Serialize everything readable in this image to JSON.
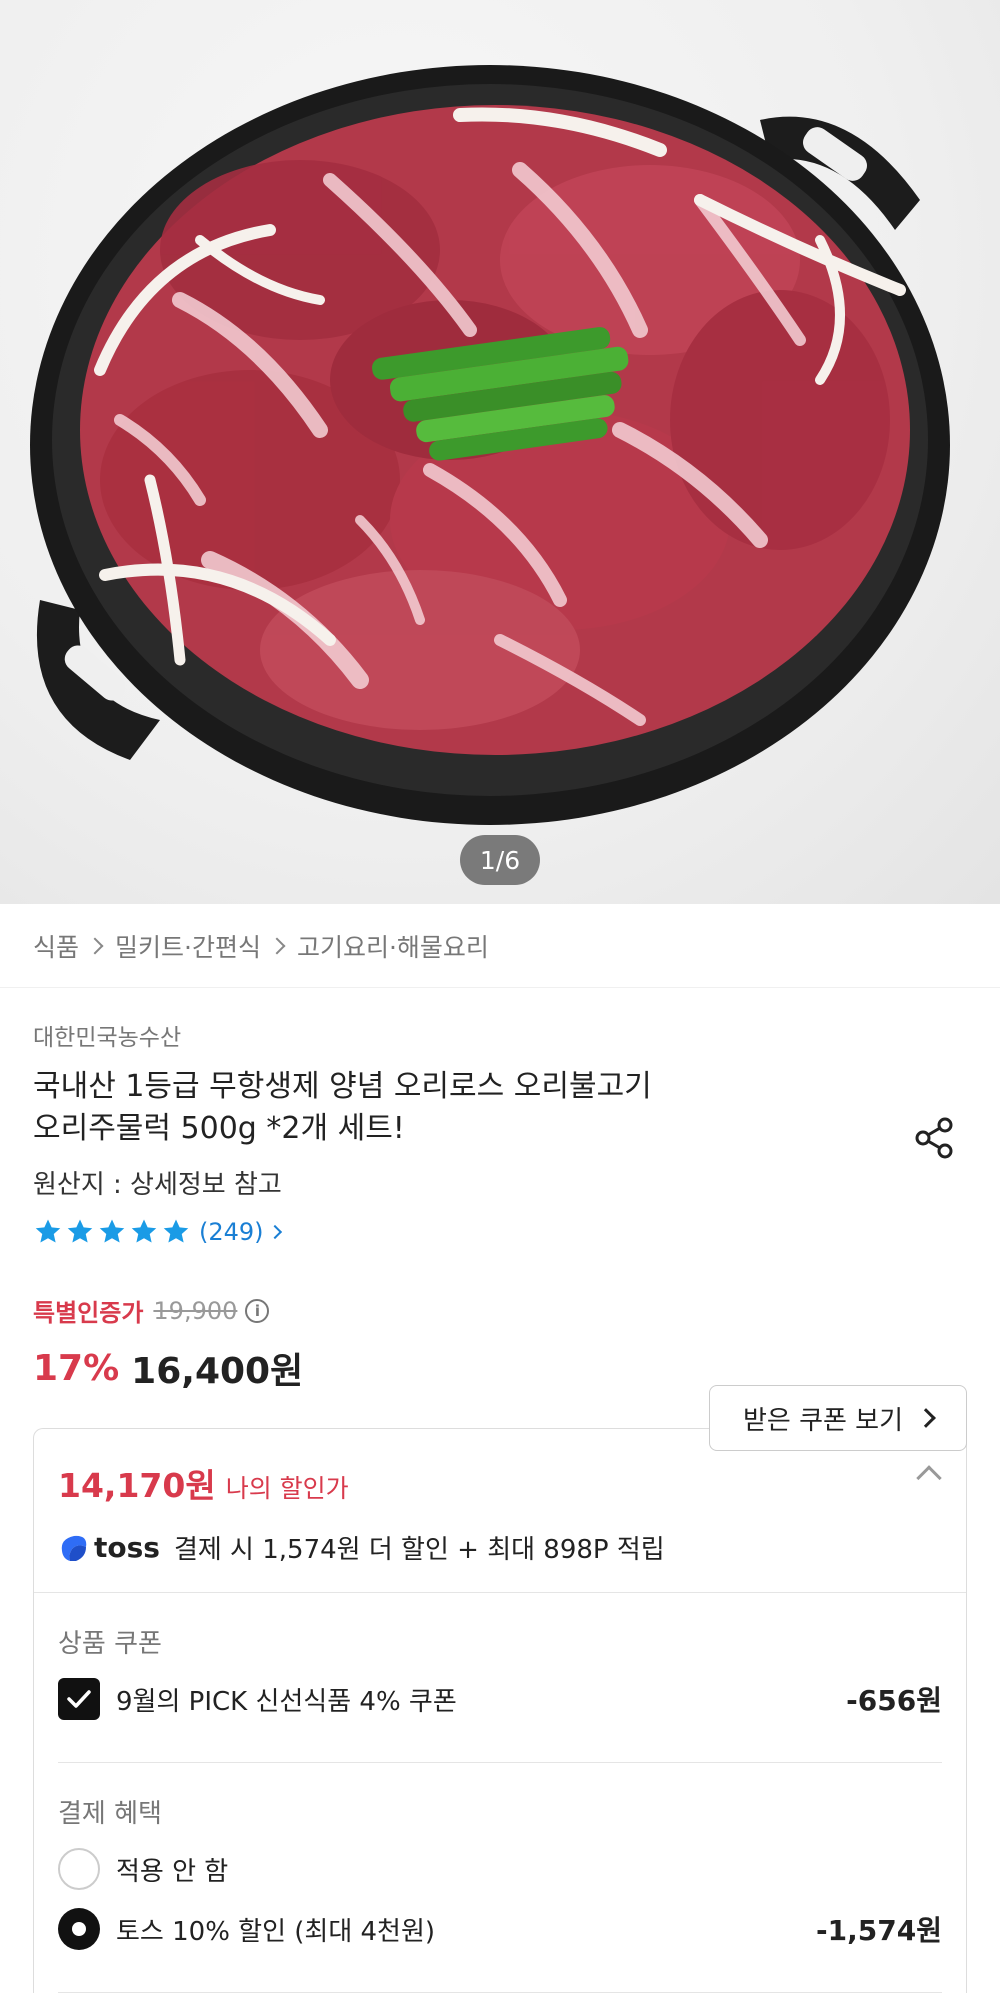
{
  "hero": {
    "page_counter": "1/6",
    "image_alt": "양념 오리불고기 무쇠팬 사진"
  },
  "breadcrumb": [
    "식품",
    "밀키트·간편식",
    "고기요리·해물요리"
  ],
  "product": {
    "brand": "대한민국농수산",
    "title_line1": "국내산 1등급 무항생제  양념 오리로스 오리불고기",
    "title_line2": "오리주물럭 500g *2개 세트!",
    "origin": "원산지 : 상세정보 참고",
    "rating_stars": 5,
    "review_count": "(249)"
  },
  "price": {
    "label": "특별인증가",
    "original": "19,900",
    "info_icon": "i",
    "discount_rate": "17%",
    "sale_price": "16,400원",
    "coupon_button": "받은 쿠폰 보기"
  },
  "discount": {
    "my_price": "14,170원",
    "my_price_label": "나의 할인가",
    "toss_brand": "toss",
    "toss_text": "결제 시 1,574원 더 할인 + 최대 898P 적립",
    "product_coupon_title": "상품 쿠폰",
    "coupon_label": "9월의 PICK 신선식품 4% 쿠폰",
    "coupon_value": "-656원",
    "payment_title": "결제 혜택",
    "pay_option1": "적용 안 함",
    "pay_option2": "토스 10% 할인 (최대 4천원)",
    "pay_option2_value": "-1,574원"
  },
  "colors": {
    "accent_red": "#d83a4c",
    "star_blue": "#1a9be6",
    "link_blue": "#1a7fd4",
    "toss_blue": "#2f6df6"
  }
}
